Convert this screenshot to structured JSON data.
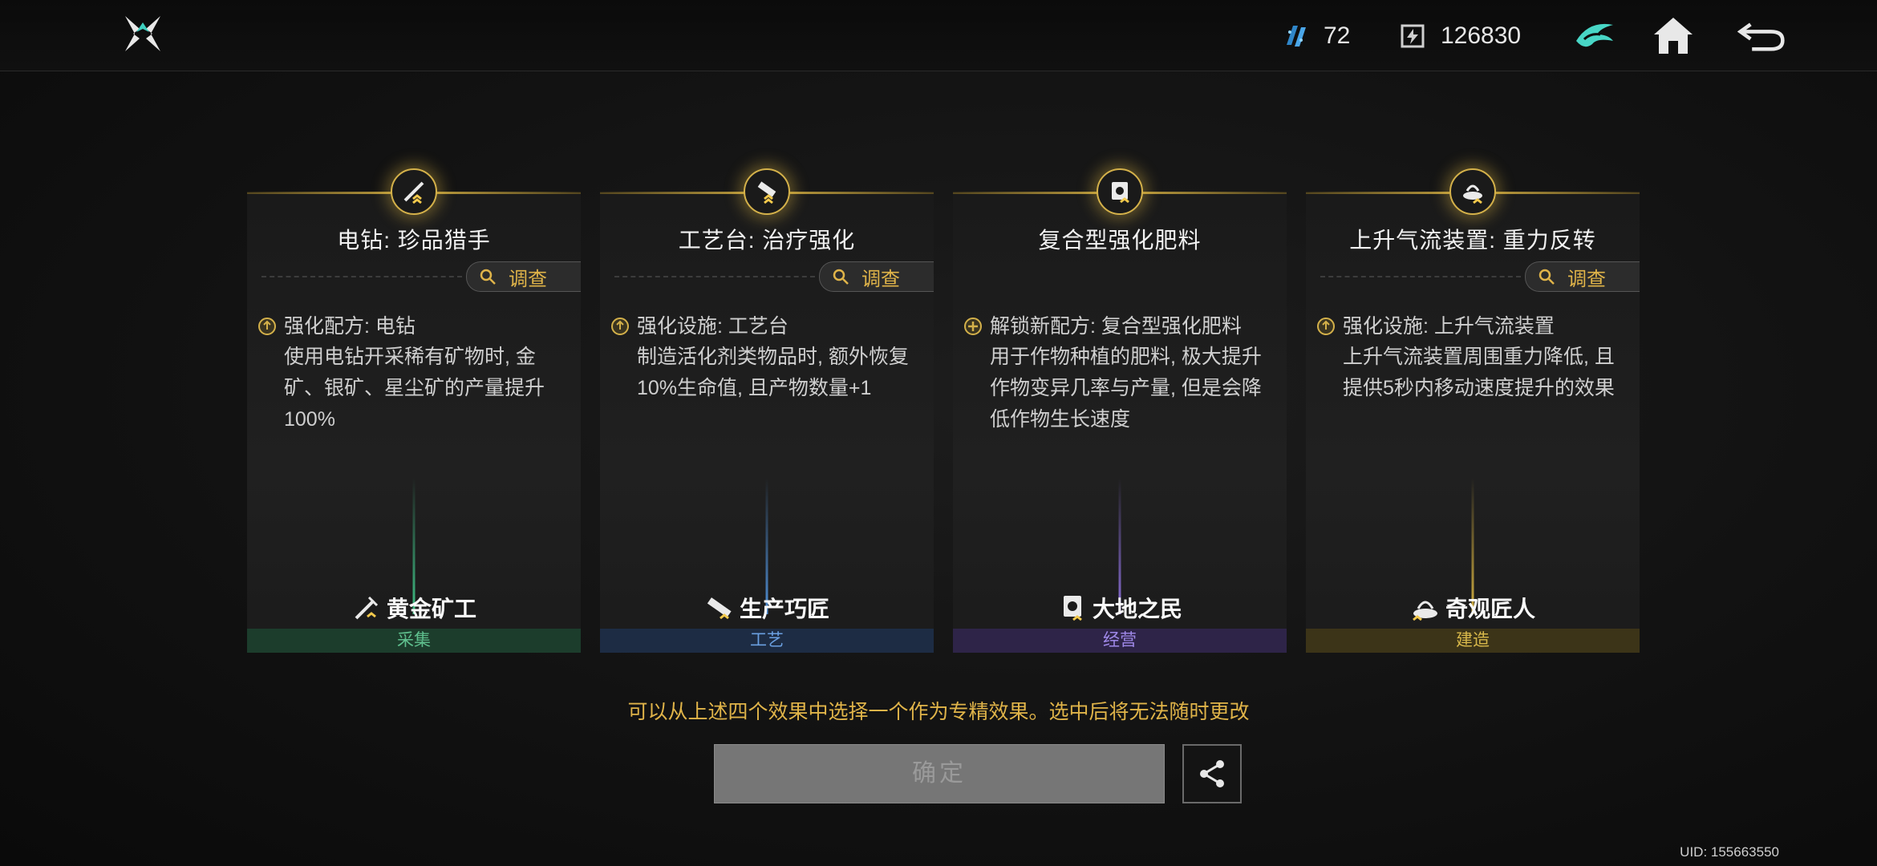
{
  "topbar": {
    "currency_1": {
      "icon": "crystal-currency-icon",
      "value": "72"
    },
    "currency_2": {
      "icon": "chip-currency-icon",
      "value": "126830"
    }
  },
  "cards": [
    {
      "title": "电钻: 珍品猎手",
      "invest_label": "调查",
      "desc_head": "强化配方: 电钻",
      "desc_body": "使用电钻开采稀有矿物时, 金矿、银矿、星尘矿的产量提升100%",
      "trait": "黄金矿工",
      "category": "采集",
      "accent": "#3fbf85"
    },
    {
      "title": "工艺台: 治疗强化",
      "invest_label": "调查",
      "desc_head": "强化设施: 工艺台",
      "desc_body": "制造活化剂类物品时, 额外恢复10%生命值, 且产物数量+1",
      "trait": "生产巧匠",
      "category": "工艺",
      "accent": "#4f8fd6"
    },
    {
      "title": "复合型强化肥料",
      "invest_label": "",
      "desc_head": "解锁新配方: 复合型强化肥料",
      "desc_body": "用于作物种植的肥料, 极大提升作物变异几率与产量, 但是会降低作物生长速度",
      "trait": "大地之民",
      "category": "经营",
      "accent": "#8b6fd8"
    },
    {
      "title": "上升气流装置: 重力反转",
      "invest_label": "调查",
      "desc_head": "强化设施: 上升气流装置",
      "desc_body": "上升气流装置周围重力降低, 且提供5秒内移动速度提升的效果",
      "trait": "奇观匠人",
      "category": "建造",
      "accent": "#d4b040"
    }
  ],
  "notice": "可以从上述四个效果中选择一个作为专精效果。选中后将无法随时更改",
  "confirm_label": "确定",
  "uid": "UID: 155663550"
}
